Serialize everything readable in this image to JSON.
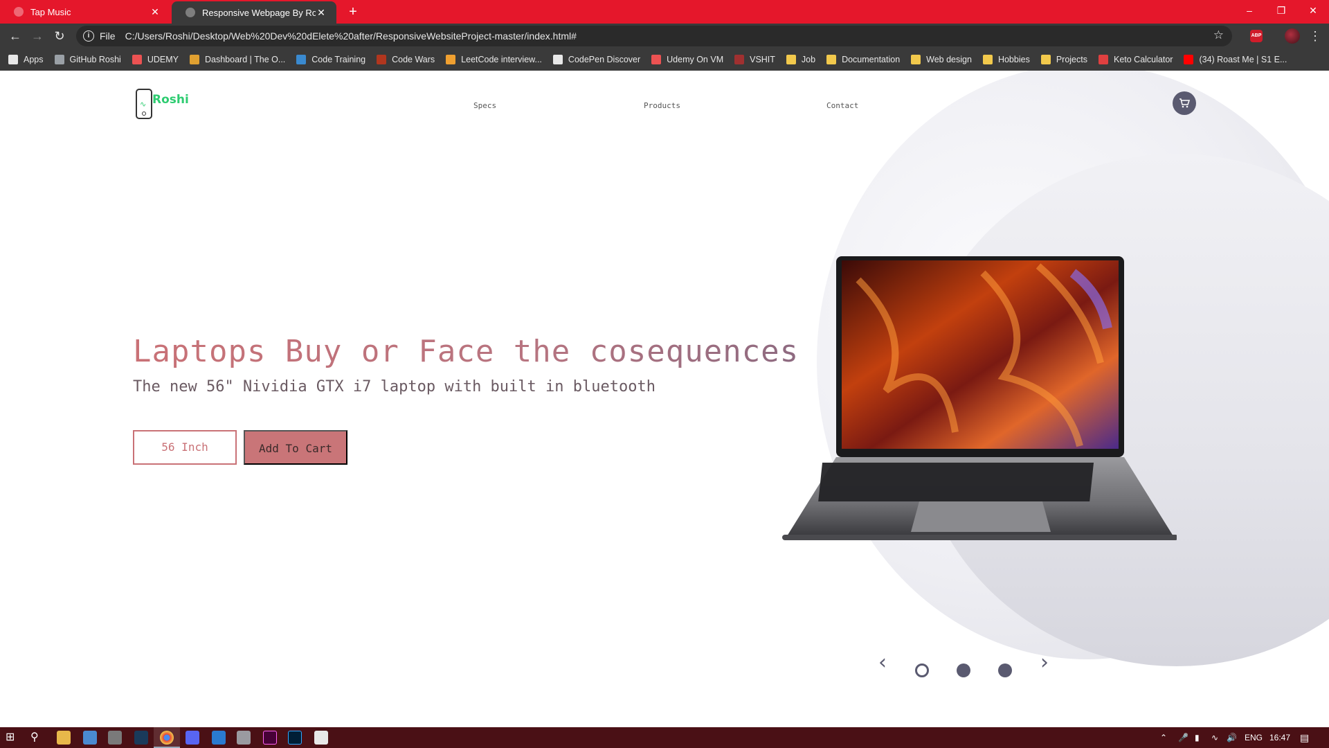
{
  "browser": {
    "tabs": [
      {
        "title": "Tap Music"
      },
      {
        "title": "Responsive Webpage By Roshi"
      }
    ],
    "new_tab": "+",
    "address": {
      "scheme": "File",
      "url": "C:/Users/Roshi/Desktop/Web%20Dev%20dElete%20after/ResponsiveWebsiteProject-master/index.html#"
    },
    "bookmarks": [
      {
        "label": "Apps",
        "color": "#e8e8e8"
      },
      {
        "label": "GitHub Roshi",
        "color": "#9aa0a6"
      },
      {
        "label": "UDEMY",
        "color": "#ec5252"
      },
      {
        "label": "Dashboard | The O...",
        "color": "#e0a030"
      },
      {
        "label": "Code Training",
        "color": "#3a8ad0"
      },
      {
        "label": "Code Wars",
        "color": "#b1361e"
      },
      {
        "label": "LeetCode interview...",
        "color": "#f0a030"
      },
      {
        "label": "CodePen Discover",
        "color": "#e8e8e8"
      },
      {
        "label": "Udemy On VM",
        "color": "#ec5252"
      },
      {
        "label": "VSHIT",
        "color": "#a03030"
      },
      {
        "label": "Job",
        "color": "#f2c94c"
      },
      {
        "label": "Documentation",
        "color": "#f2c94c"
      },
      {
        "label": "Web design",
        "color": "#f2c94c"
      },
      {
        "label": "Hobbies",
        "color": "#f2c94c"
      },
      {
        "label": "Projects",
        "color": "#f2c94c"
      },
      {
        "label": "Keto Calculator",
        "color": "#e04040"
      },
      {
        "label": "(34) Roast Me | S1 E...",
        "color": "#ff0000"
      }
    ]
  },
  "site": {
    "logo_text": "Roshi",
    "nav": [
      "Specs",
      "Products",
      "Contact"
    ],
    "hero": {
      "title": "Laptops Buy or Face the cosequences",
      "subtitle": "The new 56\" Nividia GTX i7 laptop with built in bluetooth",
      "size_button": "56 Inch",
      "cart_button": "Add To Cart"
    },
    "carousel": {
      "prev": "‹",
      "next": "›",
      "slides": 3,
      "active_slide": 1
    },
    "colors": {
      "accent": "#c97176",
      "logo_green": "#2ecc71",
      "cart_bg": "#5a5a70"
    }
  },
  "taskbar": {
    "language": "ENG",
    "time": "16:47"
  }
}
